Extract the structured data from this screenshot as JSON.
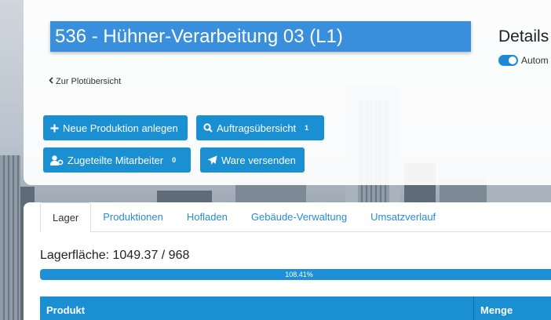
{
  "plot": {
    "title": "536 - Hühner-Verarbeitung 03 (L1)"
  },
  "details": {
    "title": "Details",
    "auto_label": "Autom"
  },
  "nav": {
    "back_label": "Zur Plotübersicht"
  },
  "actions": {
    "new_production": "Neue Produktion anlegen",
    "order_overview": "Auftragsübersicht",
    "order_count": "1",
    "assigned_staff": "Zugeteilte Mitarbeiter",
    "staff_count": "0",
    "ship_goods": "Ware versenden"
  },
  "tabs": [
    "Lager",
    "Produktionen",
    "Hofladen",
    "Gebäude-Verwaltung",
    "Umsatzverlauf"
  ],
  "storage": {
    "label": "Lagerfläche: 1049.37 / 968",
    "percent_label": "108.41%",
    "fill_fraction": 1.0
  },
  "table": {
    "headers": [
      "Produkt",
      "Menge"
    ]
  },
  "colors": {
    "accent": "#1a8fd1",
    "title_bg": "#3a8fdc"
  }
}
